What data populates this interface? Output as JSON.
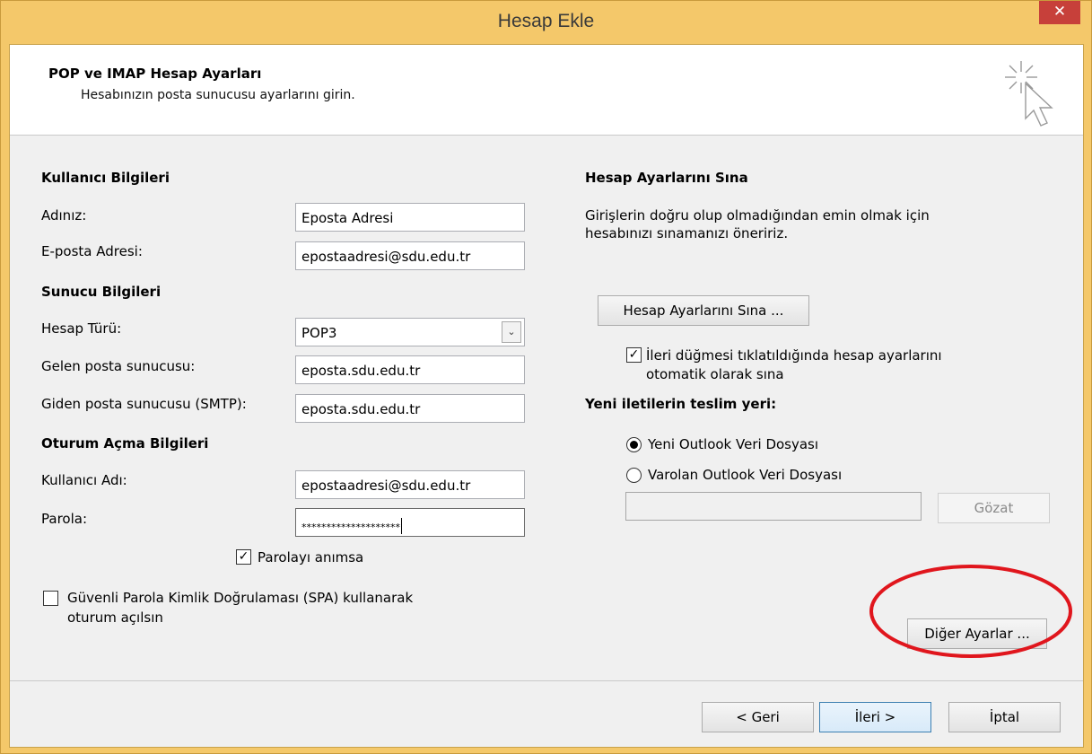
{
  "window": {
    "title": "Hesap Ekle",
    "close_symbol": "✕"
  },
  "header": {
    "title": "POP ve IMAP Hesap Ayarları",
    "subtitle": "Hesabınızın posta sunucusu ayarlarını girin."
  },
  "left": {
    "user_section": "Kullanıcı Bilgileri",
    "name_label": "Adınız:",
    "name_value": "Eposta Adresi",
    "email_label": "E-posta Adresi:",
    "email_value": "epostaadresi@sdu.edu.tr",
    "server_section": "Sunucu Bilgileri",
    "account_type_label": "Hesap Türü:",
    "account_type_value": "POP3",
    "incoming_label": "Gelen posta sunucusu:",
    "incoming_value": "eposta.sdu.edu.tr",
    "outgoing_label": "Giden posta sunucusu (SMTP):",
    "outgoing_value": "eposta.sdu.edu.tr",
    "logon_section": "Oturum Açma Bilgileri",
    "username_label": "Kullanıcı Adı:",
    "username_value": "epostaadresi@sdu.edu.tr",
    "password_label": "Parola:",
    "password_value": "********************",
    "remember_label": "Parolayı anımsa",
    "remember_checked": true,
    "spa_label_line1": "Güvenli Parola Kimlik Doğrulaması (SPA) kullanarak",
    "spa_label_line2": "oturum açılsın",
    "spa_checked": false
  },
  "right": {
    "test_section": "Hesap Ayarlarını Sına",
    "test_desc_line1": "Girişlerin doğru olup olmadığından emin olmak için",
    "test_desc_line2": "hesabınızı sınamanızı öneririz.",
    "test_button": "Hesap Ayarlarını Sına ...",
    "auto_test_line1": "İleri düğmesi tıklatıldığında hesap ayarlarını",
    "auto_test_line2": "otomatik olarak sına",
    "auto_test_checked": true,
    "delivery_section": "Yeni iletilerin teslim yeri:",
    "new_pst_label": "Yeni Outlook Veri Dosyası",
    "existing_pst_label": "Varolan Outlook Veri Dosyası",
    "selected_delivery": "new",
    "browse_button": "Gözat",
    "more_settings_button": "Diğer Ayarlar ..."
  },
  "footer": {
    "back": "< Geri",
    "next": "İleri >",
    "cancel": "İptal"
  },
  "colors": {
    "frame": "#f4c86a",
    "close": "#c7403a",
    "annotation": "#e0161d"
  }
}
